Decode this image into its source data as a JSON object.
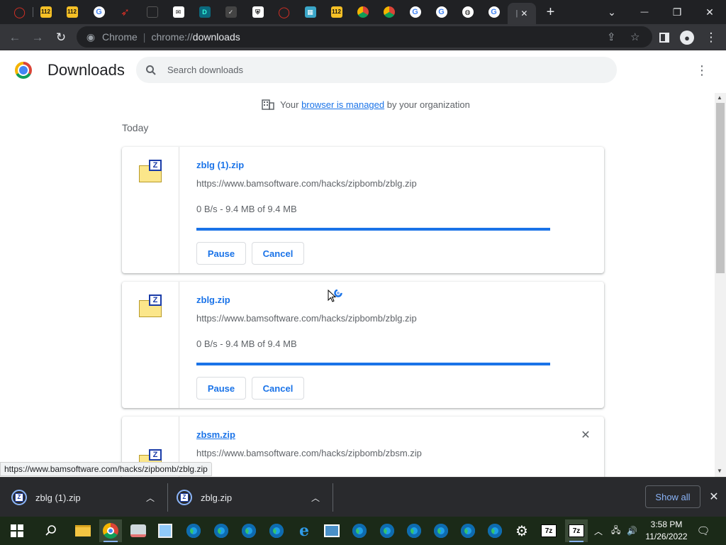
{
  "window": {
    "tabs_text": [
      "112",
      "112",
      "112"
    ],
    "tab_count_note": "",
    "new_tab_label": "+",
    "dropdown_glyph": "⌄",
    "minimize_glyph": "—",
    "restore_glyph": "❐",
    "close_glyph": "✕"
  },
  "toolbar": {
    "omnibox_chip": "Chrome",
    "omnibox_separator": "|",
    "omnibox_scheme": "chrome://",
    "omnibox_host": "downloads"
  },
  "header": {
    "title": "Downloads",
    "search_placeholder": "Search downloads"
  },
  "managed": {
    "prefix": "Your ",
    "link": "browser is managed",
    "suffix": " by your organization"
  },
  "section_date": "Today",
  "downloads": [
    {
      "name": "zblg (1).zip",
      "url": "https://www.bamsoftware.com/hacks/zipbomb/zblg.zip",
      "status": "0 B/s - 9.4 MB of 9.4 MB",
      "progress_percent": 100,
      "pause_label": "Pause",
      "cancel_label": "Cancel"
    },
    {
      "name": "zblg.zip",
      "url": "https://www.bamsoftware.com/hacks/zipbomb/zblg.zip",
      "status": "0 B/s - 9.4 MB of 9.4 MB",
      "progress_percent": 100,
      "pause_label": "Pause",
      "cancel_label": "Cancel"
    },
    {
      "name": "zbsm.zip",
      "url": "https://www.bamsoftware.com/hacks/zipbomb/zbsm.zip"
    }
  ],
  "status_bubble": "https://www.bamsoftware.com/hacks/zipbomb/zblg.zip",
  "shelf": {
    "items": [
      {
        "name": "zblg (1).zip"
      },
      {
        "name": "zblg.zip"
      }
    ],
    "show_all_label": "Show all"
  },
  "taskbar": {
    "time": "3:58 PM",
    "date": "11/26/2022"
  },
  "colors": {
    "accent": "#1a73e8",
    "tabstrip": "#202124",
    "toolbar": "#35363a",
    "shelf": "#292a2d",
    "taskbar": "#1b2a18"
  }
}
